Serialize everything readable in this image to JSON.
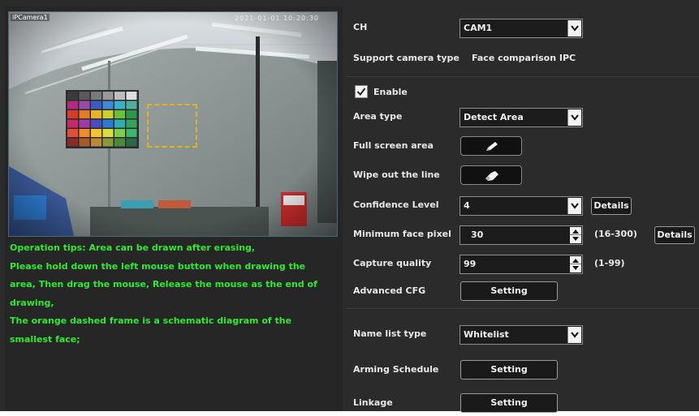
{
  "preview": {
    "camera_label": "IPCamera1",
    "timestamp": "2021-01-01 10:20:30",
    "swatch_colors": [
      [
        "#3a3a3a",
        "#5a5a5a",
        "#7a7a7a",
        "#9a9a9a",
        "#bdbdbd",
        "#dedede"
      ],
      [
        "#b22a7a",
        "#9a4aa8",
        "#3a5bbf",
        "#3d8ad6",
        "#39b0c7",
        "#4cb09a"
      ],
      [
        "#d43c2c",
        "#e37a25",
        "#e9b424",
        "#c9d12a",
        "#67c23a",
        "#2a9a4a"
      ],
      [
        "#c72a66",
        "#a03aa5",
        "#4a4ac2",
        "#2a7ad2",
        "#2ab0b0",
        "#37a25a"
      ],
      [
        "#e64a3a",
        "#f28a2a",
        "#f7c52a",
        "#d8e03a",
        "#7ad04a",
        "#38b86a"
      ],
      [
        "#8a2a2a",
        "#a85a2a",
        "#b88a3a",
        "#8a9a3a",
        "#4a8a3a",
        "#2a6a4a"
      ]
    ]
  },
  "tips": [
    "Operation tips: Area can be drawn after erasing,",
    "Please hold down the left mouse button when drawing the",
    "area, Then drag the mouse, Release the mouse as the end of",
    "drawing,",
    "The orange dashed frame is a schematic diagram of the",
    "smallest face;"
  ],
  "settings": {
    "ch": {
      "label": "CH",
      "value": "CAM1"
    },
    "support_type": {
      "label": "Support camera type",
      "value": "Face comparison IPC"
    },
    "enable": {
      "label": "Enable",
      "checked": true
    },
    "area_type": {
      "label": "Area type",
      "value": "Detect Area"
    },
    "full_screen": {
      "label": "Full screen area",
      "icon": "pencil-icon"
    },
    "wipe_line": {
      "label": "Wipe out the line",
      "icon": "eraser-icon"
    },
    "confidence": {
      "label": "Confidence Level",
      "value": "4",
      "details_label": "Details"
    },
    "min_face": {
      "label": "Minimum face pixel",
      "value": "30",
      "range": "(16-300)",
      "details_label": "Details"
    },
    "capture_quality": {
      "label": "Capture quality",
      "value": "99",
      "range": "(1-99)"
    },
    "advanced": {
      "label": "Advanced CFG",
      "button": "Setting"
    },
    "name_list": {
      "label": "Name list type",
      "value": "Whitelist"
    },
    "arming": {
      "label": "Arming Schedule",
      "button": "Setting"
    },
    "linkage": {
      "label": "Linkage",
      "button": "Setting"
    }
  },
  "colors": {
    "tip_text": "#2fea2f",
    "face_frame": "#e3b21c",
    "background": "#2b2b2b"
  }
}
